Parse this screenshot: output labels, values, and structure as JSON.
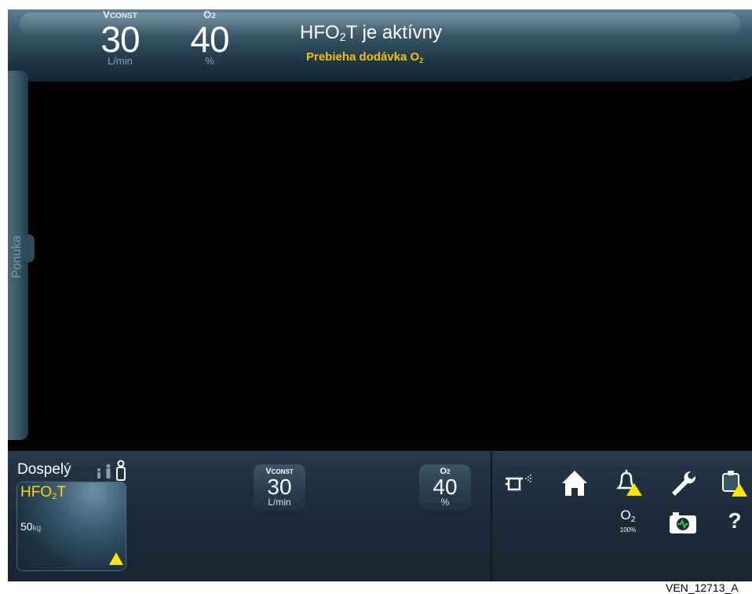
{
  "top_bar": {
    "flow": {
      "label": "V",
      "label_sub": "CONST",
      "value": "30",
      "unit": "L/min"
    },
    "o2": {
      "label": "O",
      "label_sub": "2",
      "value": "40",
      "unit": "%"
    },
    "status_title": "HFO",
    "status_title_sub": "2",
    "status_title_rest": "T je aktívny",
    "status_sub": "Prebieha dodávka O",
    "status_sub_sub": "2"
  },
  "menu": {
    "label": "Ponuka"
  },
  "patient": {
    "group": "Dospelý",
    "mode": "HFO",
    "mode_sub": "2",
    "mode_rest": "T",
    "weight": "50",
    "weight_unit": "kg"
  },
  "controls": {
    "flow": {
      "label": "V",
      "label_sub": "CONST",
      "value": "30",
      "unit": "L/min"
    },
    "o2": {
      "label": "O",
      "label_sub": "2",
      "value": "40",
      "unit": "%"
    }
  },
  "toolbar": {
    "o2_label": "O",
    "o2_sub": "2",
    "o2_pct": "100%",
    "help": "?"
  },
  "icons": [
    "nebulizer-icon",
    "home-icon",
    "alarm-bell-icon",
    "wrench-icon",
    "event-log-icon",
    "camera-icon",
    "help-icon",
    "warning-triangle-icon"
  ],
  "colors": {
    "accent_yellow": "#ffd400",
    "panel": "#1c2c3a",
    "background": "#000000"
  },
  "footer": {
    "code": "VEN_12713_A"
  }
}
